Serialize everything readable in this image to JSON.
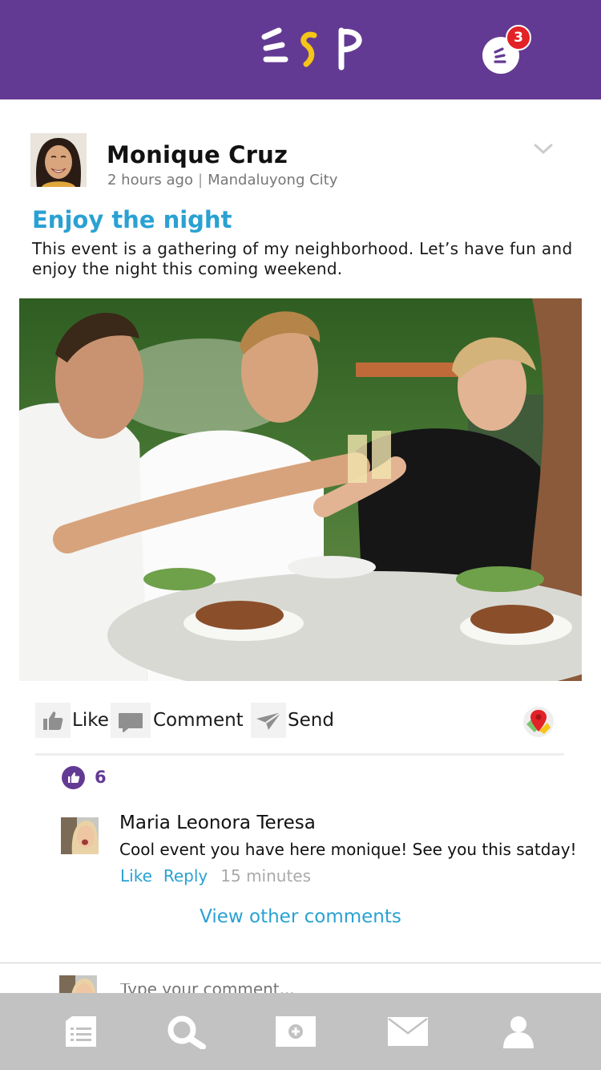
{
  "header": {
    "logo_text": "ESP",
    "notification_count": "3",
    "colors": {
      "bar": "#633a93",
      "badge": "#e32227"
    }
  },
  "post": {
    "author": "Monique Cruz",
    "time_ago": "2 hours ago",
    "separator": "|",
    "location": "Mandaluyong City",
    "title": "Enjoy the night",
    "body": "This event is a gathering of my neighborhood. Let’s have fun and enjoy the night this coming weekend.",
    "actions": {
      "like": "Like",
      "comment": "Comment",
      "send": "Send"
    },
    "like_count": "6"
  },
  "comment": {
    "name": "Maria Leonora Teresa",
    "text": "Cool event you have here monique! See you this satday!",
    "like": "Like",
    "reply": "Reply",
    "time": "15 minutes"
  },
  "view_other_comments": "View other comments",
  "compose": {
    "placeholder": "Type your comment..."
  },
  "bottom_nav": {
    "items": [
      "feed-icon",
      "search-icon",
      "add-post-icon",
      "messages-icon",
      "profile-icon"
    ]
  },
  "accent_colors": {
    "link": "#2aa1d2",
    "purple": "#633a93"
  }
}
